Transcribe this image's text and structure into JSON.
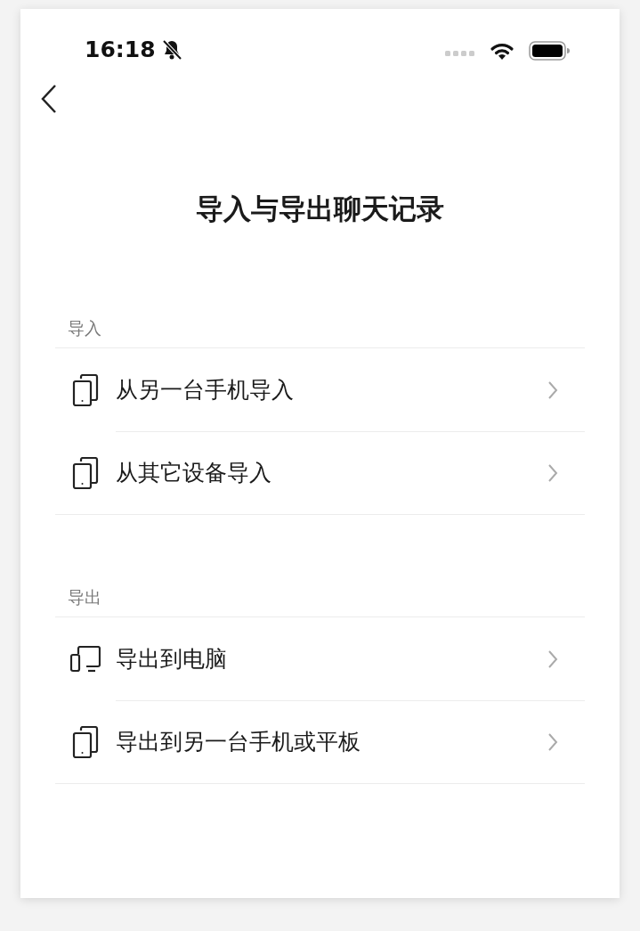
{
  "status_bar": {
    "time": "16:18",
    "muted": true
  },
  "title": "导入与导出聊天记录",
  "sections": [
    {
      "label": "导入",
      "items": [
        {
          "kind": "phone",
          "label": "从另一台手机导入"
        },
        {
          "kind": "phone",
          "label": "从其它设备导入"
        }
      ]
    },
    {
      "label": "导出",
      "items": [
        {
          "kind": "computer",
          "label": "导出到电脑"
        },
        {
          "kind": "phone",
          "label": "导出到另一台手机或平板"
        }
      ]
    }
  ]
}
